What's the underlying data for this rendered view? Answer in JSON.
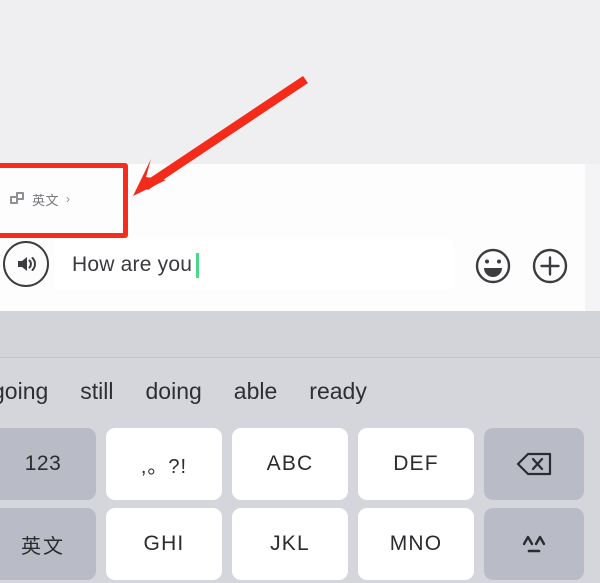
{
  "language_selector": {
    "icon": "keyboard-layout-icon",
    "label": "英文",
    "chevron": "›"
  },
  "input_bar": {
    "voice_icon": "voice-speaker-icon",
    "text_value": "How are you",
    "placeholder": "",
    "caret_color": "#4ad98a",
    "emoji_icon": "emoji-smiley-icon",
    "add_icon": "plus-circle-icon"
  },
  "suggestions": [
    {
      "label": "going"
    },
    {
      "label": "still"
    },
    {
      "label": "doing"
    },
    {
      "label": "able"
    },
    {
      "label": "ready"
    }
  ],
  "keyboard": {
    "row1": [
      {
        "label": "123",
        "type": "fn",
        "style": "num"
      },
      {
        "label": ",。?!",
        "type": "letter",
        "style": "punct"
      },
      {
        "label": "ABC",
        "type": "letter",
        "style": "plain"
      },
      {
        "label": "DEF",
        "type": "letter",
        "style": "plain"
      },
      {
        "label": "",
        "type": "fn",
        "style": "icon",
        "icon": "backspace-icon"
      }
    ],
    "row2": [
      {
        "label": "英文",
        "type": "fn",
        "style": "cn"
      },
      {
        "label": "GHI",
        "type": "letter",
        "style": "plain"
      },
      {
        "label": "JKL",
        "type": "letter",
        "style": "plain"
      },
      {
        "label": "MNO",
        "type": "letter",
        "style": "plain"
      },
      {
        "label": "",
        "type": "fn",
        "style": "icon",
        "icon": "emoticon-kaomoji-icon"
      }
    ]
  },
  "annotation": {
    "highlight_color": "#f82c1c",
    "target": "language-selector"
  }
}
